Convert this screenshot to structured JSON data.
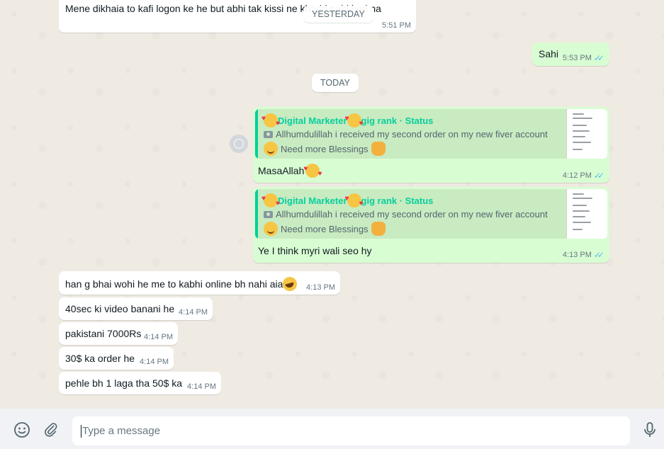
{
  "messages": {
    "m1": {
      "text": "Mene dikhaia to kafi logon ke he but abhi tak kissi ne kharid nahi kari na",
      "time": "5:51 PM"
    },
    "day_yesterday": "YESTERDAY",
    "m2": {
      "text": "Sahi",
      "time": "5:53 PM"
    },
    "day_today": "TODAY",
    "m3": {
      "quote_author": "Digital Marketer",
      "quote_suffix": " gig rank · Status",
      "quote_line1": "Allhumdulillah i received my second order on my new fiver account",
      "quote_line2": "Need more Blessings",
      "text": "MasaAllah",
      "time": "4:12 PM"
    },
    "m4": {
      "quote_author": "Digital Marketer",
      "quote_suffix": " gig rank · Status",
      "quote_line1": "Allhumdulillah i received my second order on my new fiver account",
      "quote_line2": "Need more Blessings",
      "text": "Ye I think myri wali seo hy",
      "time": "4:13 PM"
    },
    "m5": {
      "text": "han g bhai wohi he me to kabhi online bh nahi aia",
      "time": "4:13 PM"
    },
    "m6": {
      "text": "40sec ki video banani he",
      "time": "4:14 PM"
    },
    "m7": {
      "text": "pakistani 7000Rs",
      "time": "4:14 PM"
    },
    "m8": {
      "text": "30$ ka order he",
      "time": "4:14 PM"
    },
    "m9": {
      "text": "pehle bh 1 laga tha 50$ ka",
      "time": "4:14 PM"
    }
  },
  "composer": {
    "placeholder": "Type a message"
  },
  "icons": {
    "emoji": "emoji-icon",
    "attach": "paperclip-icon",
    "mic": "microphone-icon",
    "read": "double-check-icon"
  },
  "colors": {
    "outgoing": "#d9fdd3",
    "incoming": "#ffffff",
    "status_author": "#06cf9c",
    "read_ticks": "#53bdeb"
  }
}
